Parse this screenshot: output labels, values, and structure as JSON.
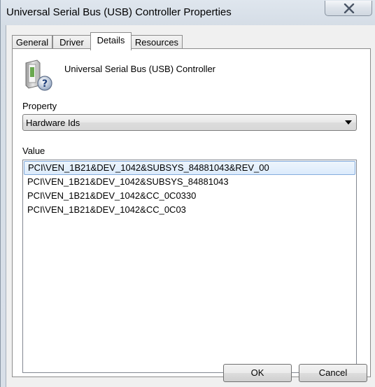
{
  "window": {
    "title": "Universal Serial Bus (USB) Controller Properties"
  },
  "tabs": [
    {
      "label": "General"
    },
    {
      "label": "Driver"
    },
    {
      "label": "Details"
    },
    {
      "label": "Resources"
    }
  ],
  "active_tab": "Details",
  "device": {
    "name": "Universal Serial Bus (USB) Controller",
    "icon": "usb-controller-unknown-icon"
  },
  "property": {
    "label": "Property",
    "selected": "Hardware Ids"
  },
  "value": {
    "label": "Value",
    "items": [
      "PCI\\VEN_1B21&DEV_1042&SUBSYS_84881043&REV_00",
      "PCI\\VEN_1B21&DEV_1042&SUBSYS_84881043",
      "PCI\\VEN_1B21&DEV_1042&CC_0C0330",
      "PCI\\VEN_1B21&DEV_1042&CC_0C03"
    ],
    "selected_index": 0
  },
  "buttons": {
    "ok": "OK",
    "cancel": "Cancel"
  },
  "colors": {
    "selection_fill": "#dcebfc",
    "selection_border": "#84acdd",
    "close_icon": "#4a5566"
  }
}
